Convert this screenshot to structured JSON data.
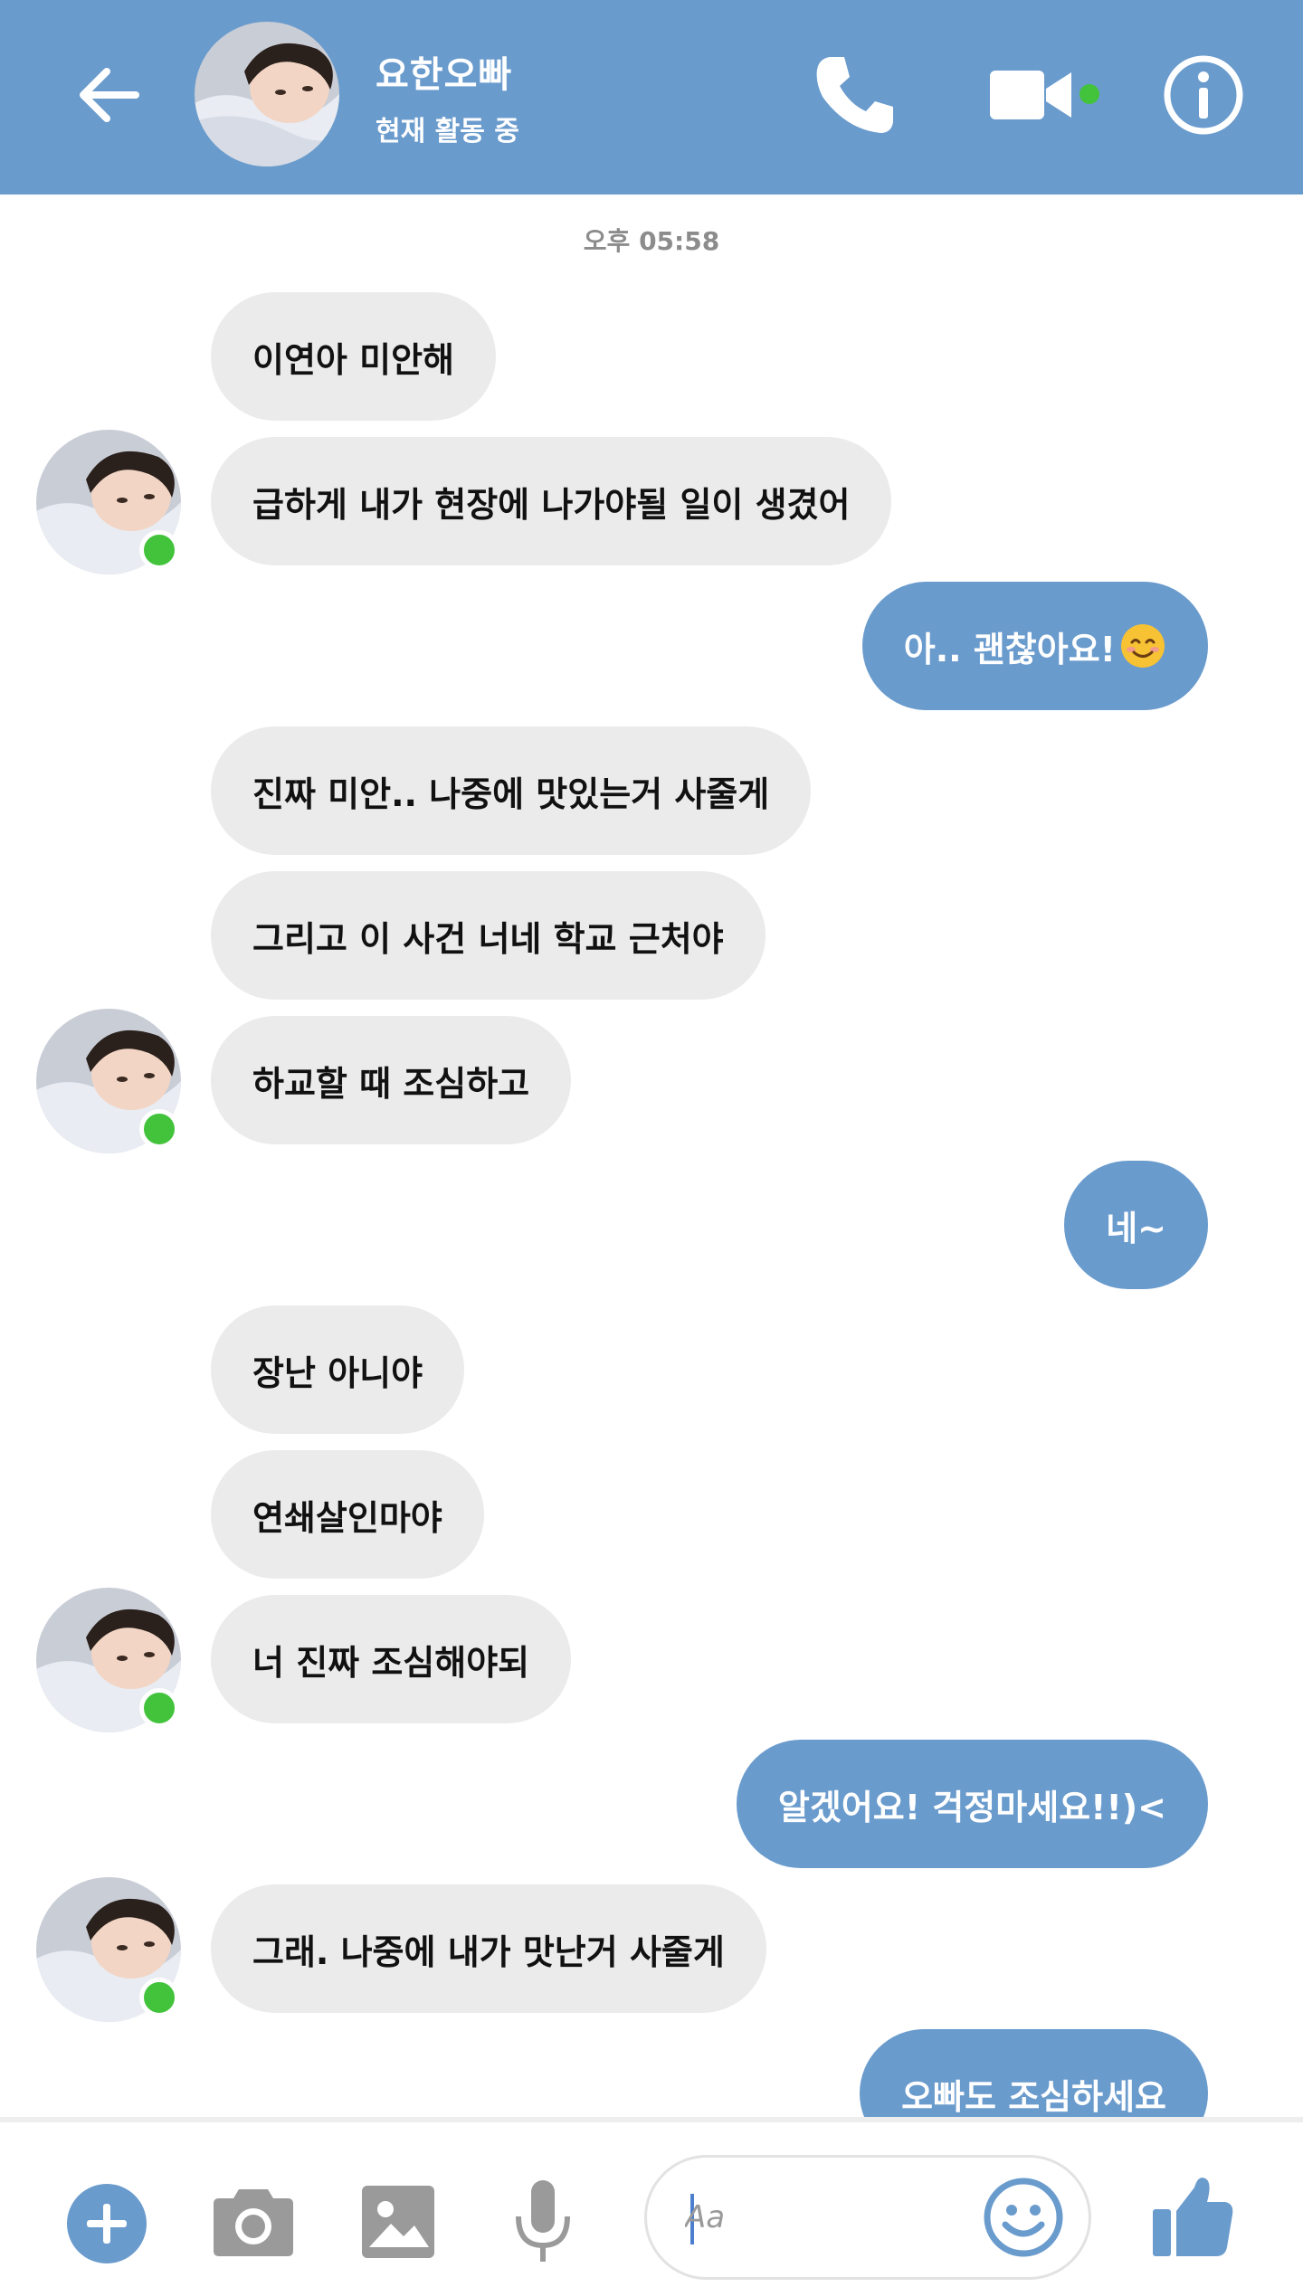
{
  "colors": {
    "accent": "#6a9bcd",
    "incoming_bubble": "#ebebeb",
    "online": "#42c33b"
  },
  "header": {
    "contact_name": "요한오빠",
    "status": "현재 활동 중",
    "icons": [
      "back-arrow-icon",
      "phone-icon",
      "video-camera-icon",
      "info-icon"
    ]
  },
  "conversation": {
    "timestamp": "오후 05:58",
    "messages": [
      {
        "from": "them",
        "text": "이연아 미안해"
      },
      {
        "from": "them",
        "text": "급하게 내가 현장에 나가야될 일이 생겼어"
      },
      {
        "from": "me",
        "text": "아.. 괜찮아요!",
        "emoji": "smiling-face-emoji"
      },
      {
        "from": "them",
        "text": "진짜 미안.. 나중에 맛있는거 사줄게"
      },
      {
        "from": "them",
        "text": "그리고 이 사건 너네 학교 근처야"
      },
      {
        "from": "them",
        "text": "하교할 때 조심하고"
      },
      {
        "from": "me",
        "text": "네~"
      },
      {
        "from": "them",
        "text": "장난 아니야"
      },
      {
        "from": "them",
        "text": "연쇄살인마야"
      },
      {
        "from": "them",
        "text": "너 진짜 조심해야되"
      },
      {
        "from": "me",
        "text": "알겠어요! 걱정마세요!!)<"
      },
      {
        "from": "them",
        "text": "그래. 나중에 내가 맛난거 사줄게"
      },
      {
        "from": "me",
        "text": "오빠도 조심하세요"
      }
    ]
  },
  "composer": {
    "placeholder": "Aa",
    "icons": [
      "plus-icon",
      "camera-icon",
      "image-icon",
      "microphone-icon",
      "emoji-icon",
      "thumbs-up-icon"
    ]
  }
}
